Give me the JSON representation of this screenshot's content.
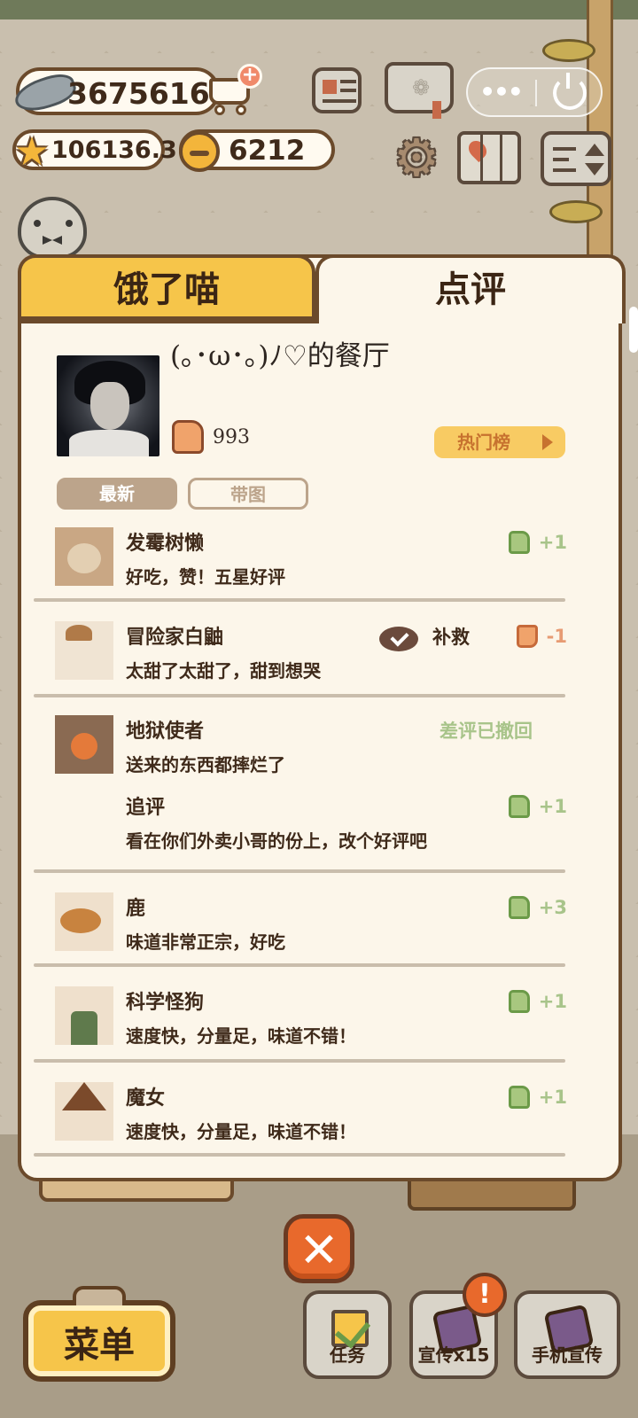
{
  "hud": {
    "fish_count": "36756160",
    "star_value": "106136.3",
    "bell_count": "6212"
  },
  "panel": {
    "tabs": [
      {
        "label": "饿了喵",
        "active": false
      },
      {
        "label": "点评",
        "active": true
      }
    ],
    "restaurant": {
      "name": "(｡･ω･｡)ﾉ♡的餐厅",
      "likes": "993"
    },
    "hot_list_label": "热门榜",
    "filters": [
      {
        "label": "最新",
        "selected": true
      },
      {
        "label": "带图",
        "selected": false
      }
    ],
    "reviews": [
      {
        "name": "发霉树懒",
        "text": "好吃，赞！五星好评",
        "score": "+1"
      },
      {
        "name": "冒险家白鼬",
        "text": "太甜了太甜了，甜到想哭",
        "remedy_label": "补救",
        "score": "-1"
      },
      {
        "name": "地狱使者",
        "text": "送来的东西都摔烂了",
        "status": "差评已撤回",
        "followup_title": "追评",
        "followup_text": "看在你们外卖小哥的份上，改个好评吧",
        "score": "+1"
      },
      {
        "name": "鹿",
        "text": "味道非常正宗，好吃",
        "score": "+3"
      },
      {
        "name": "科学怪狗",
        "text": "速度快，分量足，味道不错！",
        "score": "+1"
      },
      {
        "name": "魔女",
        "text": "速度快，分量足，味道不错！",
        "score": "+1"
      }
    ]
  },
  "bottom": {
    "menu_label": "菜单",
    "task_label": "任务",
    "promo_label": "宣传x15",
    "phone_promo_label": "手机宣传",
    "alert_badge": "!"
  },
  "colors": {
    "accent_yellow": "#f6c54a",
    "brown_outline": "#6b4a2b",
    "positive_green": "#a8c48a",
    "negative_orange": "#e79b73",
    "close_orange": "#e8692c"
  },
  "icons": {
    "fish": "fish-icon",
    "cart": "cart-add-icon",
    "star": "star-icon",
    "bell": "bell-coin-icon",
    "news": "newspaper-icon",
    "book": "paw-book-icon",
    "more": "more-dots-icon",
    "power": "power-icon",
    "settings": "gear-icon",
    "map": "map-icon",
    "sort": "sort-toggle-icon",
    "thumb_up": "thumb-up-icon",
    "thumb_down": "thumb-down-icon",
    "remedy": "chat-check-icon",
    "close": "close-icon"
  }
}
